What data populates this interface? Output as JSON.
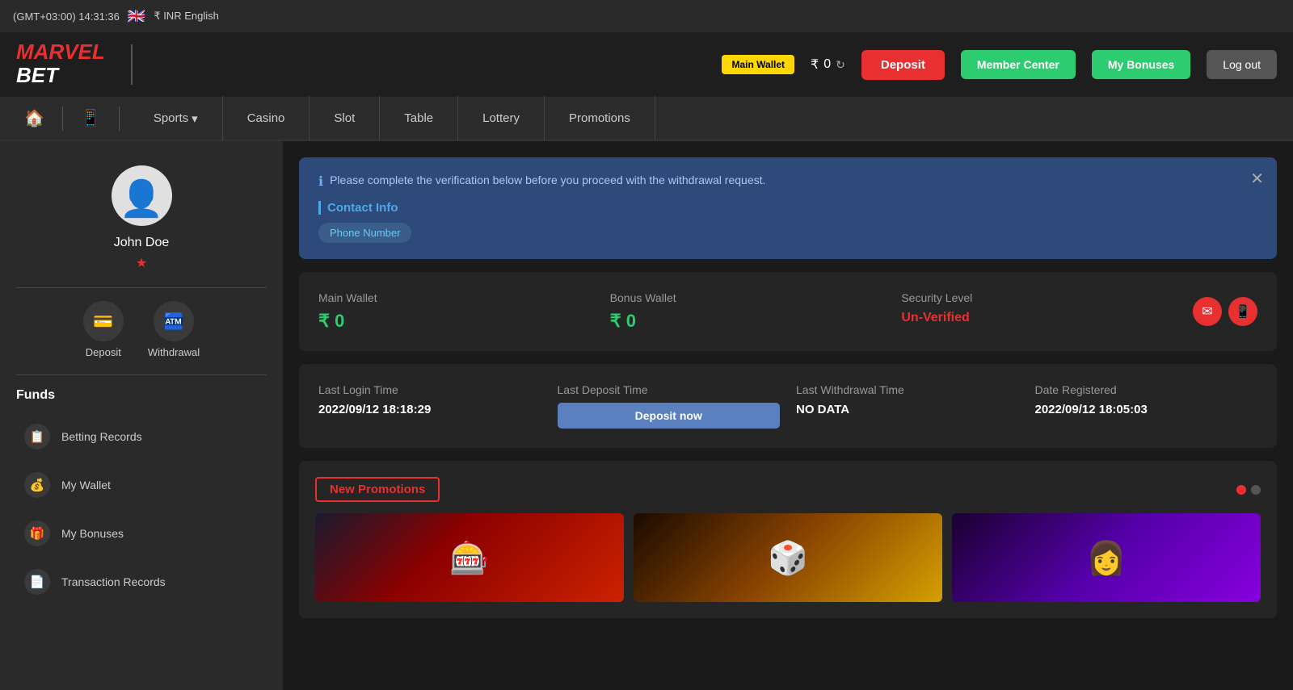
{
  "topbar": {
    "timezone": "(GMT+03:00) 14:31:36",
    "flag": "🇬🇧",
    "currency": "₹ INR English"
  },
  "header": {
    "logo_marvel": "MARVEL",
    "logo_bet": "BET",
    "wallet_label": "Main Wallet",
    "balance_symbol": "₹",
    "balance_value": "0",
    "deposit_btn": "Deposit",
    "member_center_btn": "Member Center",
    "my_bonuses_btn": "My Bonuses",
    "logout_btn": "Log out"
  },
  "nav": {
    "home_icon": "🏠",
    "mobile_icon": "📱",
    "sports": "Sports",
    "casino": "Casino",
    "slot": "Slot",
    "table": "Table",
    "lottery": "Lottery",
    "promotions": "Promotions"
  },
  "sidebar": {
    "username": "John Doe",
    "deposit_label": "Deposit",
    "withdrawal_label": "Withdrawal",
    "funds_heading": "Funds",
    "menu_items": [
      {
        "icon": "📋",
        "label": "Betting Records"
      },
      {
        "icon": "💰",
        "label": "My Wallet"
      },
      {
        "icon": "🎁",
        "label": "My Bonuses"
      },
      {
        "icon": "📄",
        "label": "Transaction Records"
      }
    ]
  },
  "verification": {
    "message": "Please complete the verification below before you proceed with the withdrawal request.",
    "contact_info_label": "Contact Info",
    "phone_badge": "Phone Number"
  },
  "wallet_info": {
    "main_wallet_label": "Main Wallet",
    "main_wallet_value": "₹ 0",
    "bonus_wallet_label": "Bonus Wallet",
    "bonus_wallet_value": "₹ 0",
    "security_level_label": "Security Level",
    "security_level_value": "Un-Verified"
  },
  "login_info": {
    "last_login_label": "Last Login Time",
    "last_login_value": "2022/09/12 18:18:29",
    "last_deposit_label": "Last Deposit Time",
    "deposit_now_btn": "Deposit now",
    "last_withdrawal_label": "Last Withdrawal Time",
    "last_withdrawal_value": "NO DATA",
    "date_registered_label": "Date Registered",
    "date_registered_value": "2022/09/12 18:05:03"
  },
  "promotions": {
    "label": "New Promotions",
    "card1_icon": "🎰",
    "card2_icon": "🎲",
    "card3_icon": "👩"
  }
}
